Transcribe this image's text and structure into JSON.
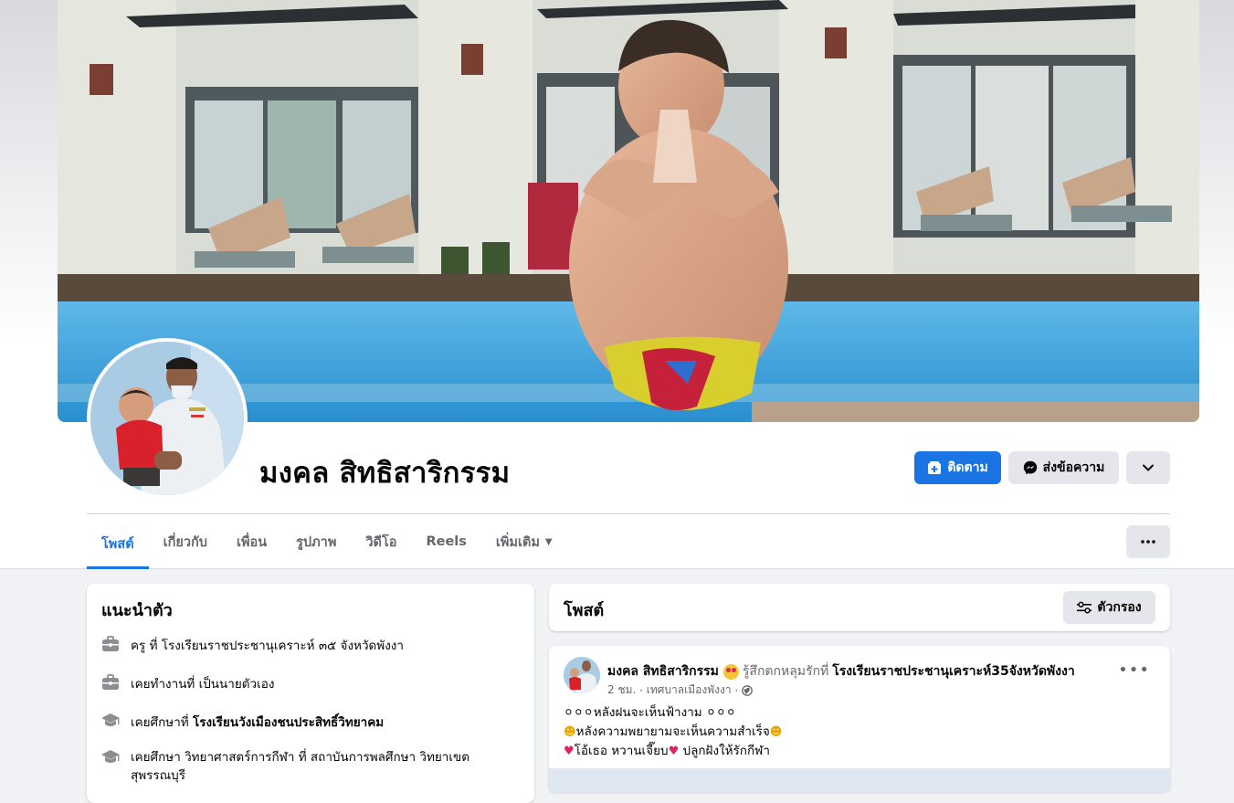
{
  "profile": {
    "name": "มงคล สิทธิสาริกรรม"
  },
  "actions": {
    "follow_label": "ติดตาม",
    "message_label": "ส่งข้อความ"
  },
  "tabs": [
    {
      "label": "โพสต์",
      "active": true
    },
    {
      "label": "เกี่ยวกับ",
      "active": false
    },
    {
      "label": "เพื่อน",
      "active": false
    },
    {
      "label": "รูปภาพ",
      "active": false
    },
    {
      "label": "วิดีโอ",
      "active": false
    },
    {
      "label": "Reels",
      "active": false
    },
    {
      "label": "เพิ่มเติม",
      "active": false
    }
  ],
  "intro": {
    "title": "แนะนำตัว",
    "items": [
      {
        "icon": "briefcase-icon",
        "text": "ครู ที่ โรงเรียนราชประชานุเคราะห์ ๓๕ จังหวัดพังงา"
      },
      {
        "icon": "briefcase-icon",
        "text": "เคยทำงานที่ เป็นนายตัวเอง"
      },
      {
        "icon": "graduation-cap-icon",
        "prefix": "เคยศึกษาที่ ",
        "bold": "โรงเรียนวังเมืองชนประสิทธิ์วิทยาคม"
      },
      {
        "icon": "graduation-cap-icon",
        "text": "เคยศึกษา วิทยาศาสตร์การกีฬา ที่ สถาบันการพลศึกษา วิทยาเขตสุพรรณบุรี"
      }
    ]
  },
  "posts_header": {
    "title": "โพสต์",
    "filter_label": "ตัวกรอง"
  },
  "post": {
    "author": "มงคล สิทธิสาริกรรม",
    "feeling": "รู้สึกตกหลุมรักที่",
    "place": "โรงเรียนราชประชานุเคราะห์35จังหวัดพังงา",
    "time": "2 ชม.",
    "location": "เทศบาลเมืองพังงา",
    "lines": [
      "หลังฝนจะเห็นฟ้างาม",
      "หลังความพยายามจะเห็นความสำเร็จ",
      "โอ้เธอ หวานเจี๊ยบ",
      "ปลูกฝังให้รักกีฬา"
    ]
  },
  "colors": {
    "accent": "#1b74e4",
    "secondary_button": "#e4e6eb",
    "page_bg": "#f0f2f5"
  }
}
